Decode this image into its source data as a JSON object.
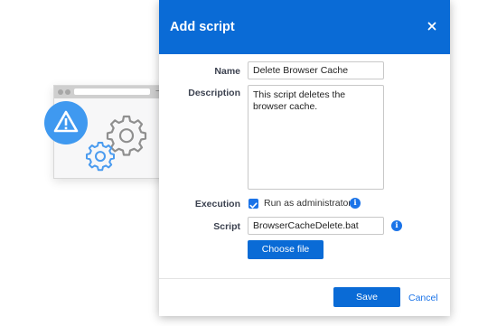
{
  "dialog": {
    "title": "Add script",
    "close_icon": "close-icon",
    "header_color": "#0a6bd6"
  },
  "form": {
    "name_label": "Name",
    "name_value": "Delete Browser Cache",
    "description_label": "Description",
    "description_value": "This script deletes the browser cache.",
    "execution_label": "Execution",
    "run_as_admin_label": "Run as administrator",
    "run_as_admin_checked": true,
    "script_label": "Script",
    "script_value": "BrowserCacheDelete.bat",
    "choose_file_label": "Choose file"
  },
  "footer": {
    "save_label": "Save",
    "cancel_label": "Cancel"
  },
  "illustration": {
    "window_controls": [
      "−",
      "□",
      "✖"
    ],
    "warning_icon": "warning-icon",
    "gear_icons": [
      "gear-icon",
      "gear-icon"
    ]
  }
}
